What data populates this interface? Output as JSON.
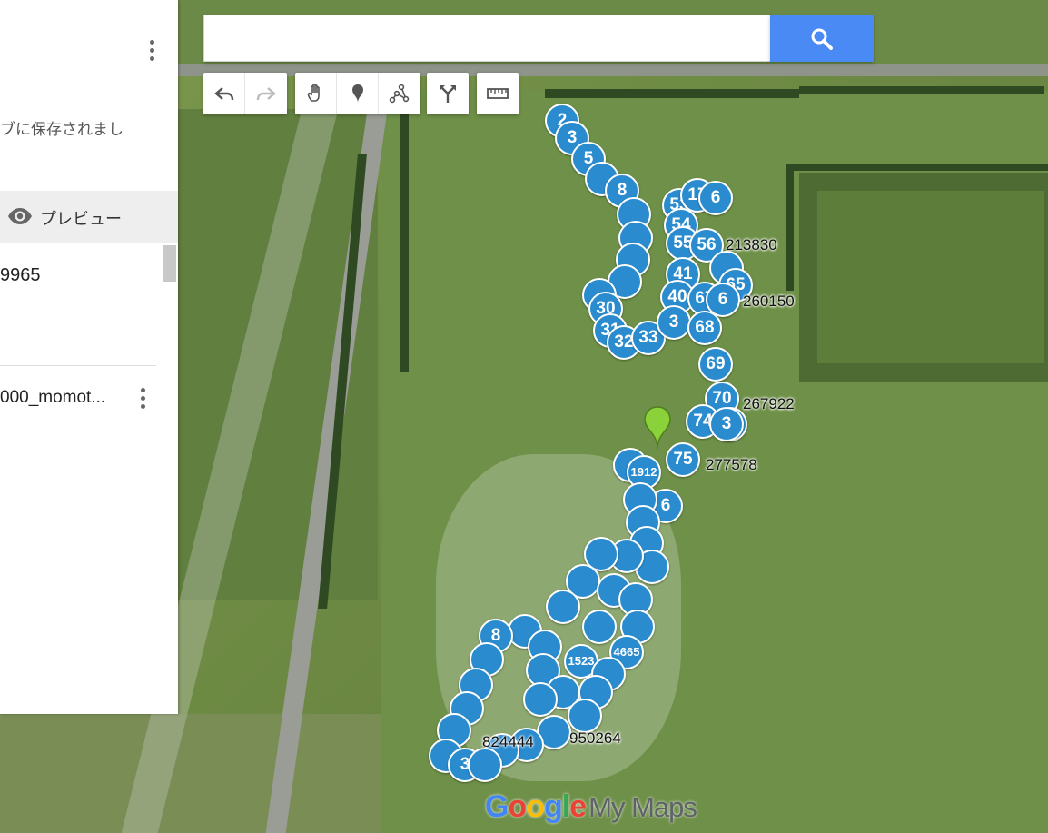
{
  "panel": {
    "saved_text": "ブに保存されまし",
    "preview_label": "プレビュー",
    "value_text": "9965",
    "layer_name": "000_momot..."
  },
  "search": {
    "placeholder": "",
    "value": ""
  },
  "toolbar": {
    "groups": [
      [
        "undo-icon",
        "redo-icon"
      ],
      [
        "hand-icon",
        "marker-icon",
        "draw-line-icon"
      ],
      [
        "directions-icon"
      ],
      [
        "ruler-icon"
      ]
    ]
  },
  "markers": [
    {
      "label": "2"
    },
    {
      "label": "3"
    },
    {
      "label": "5"
    },
    {
      "label": ""
    },
    {
      "label": "8"
    },
    {
      "label": "53"
    },
    {
      "label": "17"
    },
    {
      "label": "6"
    },
    {
      "label": "54"
    },
    {
      "label": "55"
    },
    {
      "label": "56"
    },
    {
      "label": "41"
    },
    {
      "label": "65"
    },
    {
      "label": "40"
    },
    {
      "label": "67"
    },
    {
      "label": "6"
    },
    {
      "label": "30"
    },
    {
      "label": "31"
    },
    {
      "label": "32"
    },
    {
      "label": "33"
    },
    {
      "label": "3"
    },
    {
      "label": "68"
    },
    {
      "label": "69"
    },
    {
      "label": "70"
    },
    {
      "label": "74"
    },
    {
      "label": "3"
    },
    {
      "label": "75"
    },
    {
      "label": "1912"
    },
    {
      "label": "6"
    },
    {
      "label": "8"
    },
    {
      "label": "1523"
    },
    {
      "label": "4665"
    },
    {
      "label": "3"
    }
  ],
  "timestamps": [
    "213830",
    "260150",
    "267922",
    "277578",
    "824444",
    "950264"
  ],
  "logo": {
    "google": [
      "G",
      "o",
      "o",
      "g",
      "l",
      "e"
    ],
    "mymaps": "My Maps"
  },
  "colors": {
    "marker_fill": "#2a8ccf",
    "search_button": "#4a8af4",
    "pin": "#8bd13a"
  }
}
